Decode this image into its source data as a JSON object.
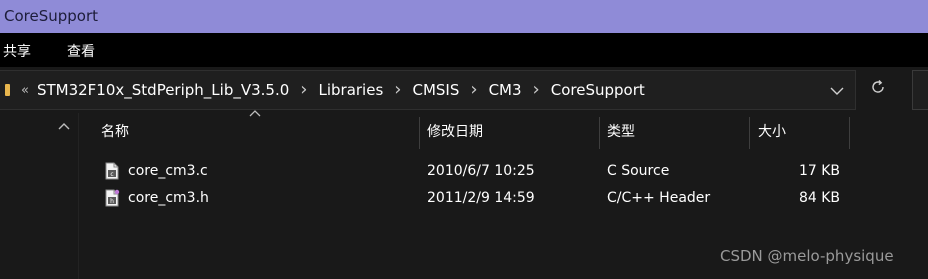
{
  "window": {
    "title": "CoreSupport"
  },
  "menu": {
    "share_label": "共享",
    "view_label": "查看"
  },
  "address": {
    "overflow_glyph": "«",
    "separator_glyph": "›",
    "crumbs": [
      "STM32F10x_StdPeriph_Lib_V3.5.0",
      "Libraries",
      "CMSIS",
      "CM3",
      "CoreSupport"
    ]
  },
  "columns": {
    "name": "名称",
    "modified": "修改日期",
    "type": "类型",
    "size": "大小"
  },
  "files": [
    {
      "name": "core_cm3.c",
      "modified": "2010/6/7 10:25",
      "type": "C Source",
      "size": "17 KB",
      "icon": "c-source-file-icon"
    },
    {
      "name": "core_cm3.h",
      "modified": "2011/2/9 14:59",
      "type": "C/C++ Header",
      "size": "84 KB",
      "icon": "c-header-file-icon"
    }
  ],
  "watermark": "CSDN @melo-physique",
  "colors": {
    "titlebar": "#8f8bd7",
    "menubar": "#000000",
    "background": "#191919",
    "folder": "#e8b64d"
  }
}
